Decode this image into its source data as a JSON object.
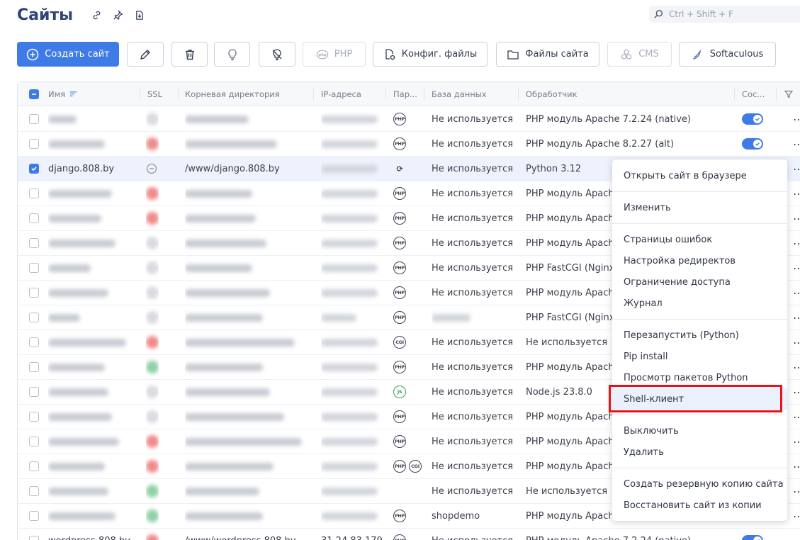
{
  "header": {
    "title": "Сайты",
    "icons": [
      "link-icon",
      "pin-icon",
      "export-icon"
    ]
  },
  "search": {
    "placeholder": "Ctrl + Shift + F"
  },
  "toolbar": {
    "create_label": "Создать сайт",
    "php_label": "PHP",
    "config_label": "Конфиг. файлы",
    "files_label": "Файлы сайта",
    "cms_label": "CMS",
    "softaculous_label": "Softaculous"
  },
  "table": {
    "columns": {
      "name": "Имя",
      "ssl": "SSL",
      "root": "Корневая директория",
      "ip": "IP-адреса",
      "params": "Пар...",
      "db": "База данных",
      "handler": "Обработчик",
      "status": "Сос..."
    },
    "rows": [
      {
        "name": "",
        "root": "",
        "handler_icon": "PHP",
        "db": "Не используется",
        "handler": "PHP модуль Apache 7.2.24 (native)",
        "toggle": true,
        "ssl_color": "#d9dbe0"
      },
      {
        "name": "",
        "root": "",
        "handler_icon": "PHP",
        "db": "Не используется",
        "handler": "PHP модуль Apache 8.2.27 (alt)",
        "toggle": true,
        "ssl_color": "#f08a8a"
      },
      {
        "name": "django.808.by",
        "root": "/www/django.808.by",
        "handler_icon": "PY",
        "db": "Не используется",
        "handler": "Python 3.12",
        "toggle": false,
        "selected": true,
        "ssl_color": ""
      },
      {
        "name": "",
        "root": "",
        "handler_icon": "PHP",
        "db": "Не используется",
        "handler": "PHP модуль Apache",
        "toggle": false,
        "ssl_color": "#f08a8a"
      },
      {
        "name": "",
        "root": "",
        "handler_icon": "PHP",
        "db": "Не используется",
        "handler": "PHP модуль Apache",
        "toggle": false,
        "ssl_color": "#f08a8a"
      },
      {
        "name": "",
        "root": "",
        "handler_icon": "PHP",
        "db": "Не используется",
        "handler": "PHP модуль Apache",
        "toggle": false,
        "ssl_color": "#d9dbe0"
      },
      {
        "name": "",
        "root": "",
        "handler_icon": "PHP",
        "db": "Не используется",
        "handler": "PHP FastCGI (Nginx",
        "toggle": false,
        "ssl_color": "#d9dbe0"
      },
      {
        "name": "",
        "root": "",
        "handler_icon": "PHP",
        "db": "Не используется",
        "handler": "PHP модуль Apache",
        "toggle": false,
        "ssl_color": "#d9dbe0"
      },
      {
        "name": "",
        "root": "",
        "handler_icon": "PHP",
        "db": "",
        "handler": "PHP FastCGI (Nginx",
        "toggle": false,
        "ssl_color": "#d9dbe0"
      },
      {
        "name": "",
        "root": "",
        "handler_icon": "CGI",
        "db": "Не используется",
        "handler": "Не используется",
        "toggle": false,
        "ssl_color": "#f08a8a"
      },
      {
        "name": "",
        "root": "",
        "handler_icon": "PHP",
        "db": "Не используется",
        "handler": "PHP модуль Apache",
        "toggle": false,
        "ssl_color": "#8fd1a5"
      },
      {
        "name": "",
        "root": "",
        "handler_icon": "JS",
        "db": "Не используется",
        "handler": "Node.js 23.8.0",
        "toggle": false,
        "ssl_color": "#d9dbe0"
      },
      {
        "name": "",
        "root": "",
        "handler_icon": "PHP",
        "db": "Не используется",
        "handler": "PHP модуль Apache",
        "toggle": false,
        "ssl_color": "#d9dbe0"
      },
      {
        "name": "",
        "root": "",
        "handler_icon": "PHP",
        "db": "Не используется",
        "handler": "PHP модуль Apache",
        "toggle": false,
        "ssl_color": "#f08a8a"
      },
      {
        "name": "",
        "root": "",
        "handler_icon": "PHP CGI",
        "db": "Не используется",
        "handler": "PHP модуль Apache",
        "toggle": false,
        "ssl_color": "#f08a8a"
      },
      {
        "name": "",
        "root": "",
        "handler_icon": "",
        "db": "Не используется",
        "handler": "Не используется",
        "toggle": false,
        "ssl_color": "#8fd1a5"
      },
      {
        "name": "",
        "root": "",
        "handler_icon": "PHP",
        "db": "shopdemo",
        "handler": "PHP модуль Apache",
        "toggle": false,
        "ssl_color": "#8fd1a5"
      },
      {
        "name": "wordpress.808.by",
        "root": "/www/wordpress.808.by",
        "ip": "31.24.83.179",
        "handler_icon": "PHP",
        "db": "Не используется",
        "handler": "PHP модуль Apache 7.2.24 (native)",
        "toggle": true,
        "ssl_color": "#f08a8a"
      }
    ]
  },
  "context_menu": {
    "items": [
      {
        "label": "Открыть сайт в браузере",
        "group": 1
      },
      {
        "label": "Изменить",
        "group": 2
      },
      {
        "label": "Страницы ошибок",
        "group": 3
      },
      {
        "label": "Настройка редиректов",
        "group": 3
      },
      {
        "label": "Ограничение доступа",
        "group": 3
      },
      {
        "label": "Журнал",
        "group": 3
      },
      {
        "label": "Перезапустить (Python)",
        "group": 4
      },
      {
        "label": "Pip install",
        "group": 4
      },
      {
        "label": "Просмотр пакетов Python",
        "group": 4
      },
      {
        "label": "Shell-клиент",
        "group": 4,
        "hover": true
      },
      {
        "label": "Выключить",
        "group": 5
      },
      {
        "label": "Удалить",
        "group": 5
      },
      {
        "label": "Создать резервную копию сайта",
        "group": 6
      },
      {
        "label": "Восстановить сайт из копии",
        "group": 6
      }
    ]
  },
  "colors": {
    "accent": "#3e7be6",
    "title": "#2c4476",
    "highlight_box": "#e8121c"
  }
}
